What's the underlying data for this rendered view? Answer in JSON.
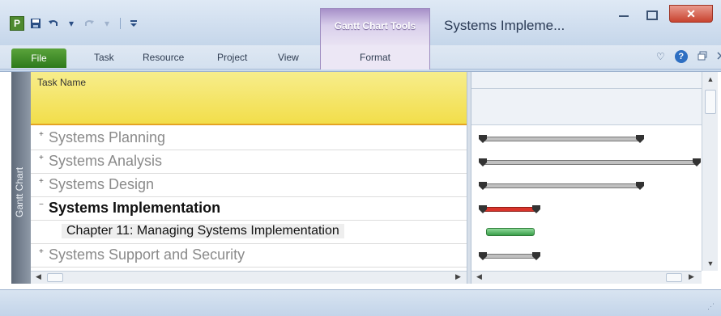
{
  "window": {
    "app_icon_label": "P",
    "title": "Systems Impleme...",
    "contextual_group": "Gantt Chart Tools",
    "controls": {
      "minimize": "—",
      "maximize": "☐",
      "close": "✕"
    }
  },
  "quick_access": {
    "save_icon": "save-icon",
    "undo_icon": "undo-icon",
    "redo_icon": "redo-icon",
    "customize_icon": "customize-icon"
  },
  "ribbon": {
    "tabs": [
      {
        "label": "File"
      },
      {
        "label": "Task"
      },
      {
        "label": "Resource"
      },
      {
        "label": "Project"
      },
      {
        "label": "View"
      },
      {
        "label": "Format"
      }
    ]
  },
  "view": {
    "sidebar_label": "Gantt Chart",
    "column_header": "Task Name"
  },
  "tasks": [
    {
      "toggle": "+",
      "name": "Systems Planning",
      "style": "summary-collapsed"
    },
    {
      "toggle": "+",
      "name": "Systems Analysis",
      "style": "summary-collapsed"
    },
    {
      "toggle": "+",
      "name": "Systems Design",
      "style": "summary-collapsed"
    },
    {
      "toggle": "−",
      "name": "Systems Implementation",
      "style": "summary-expanded"
    },
    {
      "toggle": "",
      "name": "Chapter 11: Managing Systems Implementation",
      "style": "subtask"
    },
    {
      "toggle": "+",
      "name": "Systems Support and Security",
      "style": "summary-collapsed"
    }
  ],
  "colors": {
    "header_yellow": "#f2de4a",
    "summary_bar": "#c0c0c0",
    "critical_bar": "#d9342b",
    "task_bar": "#4cae5b"
  }
}
